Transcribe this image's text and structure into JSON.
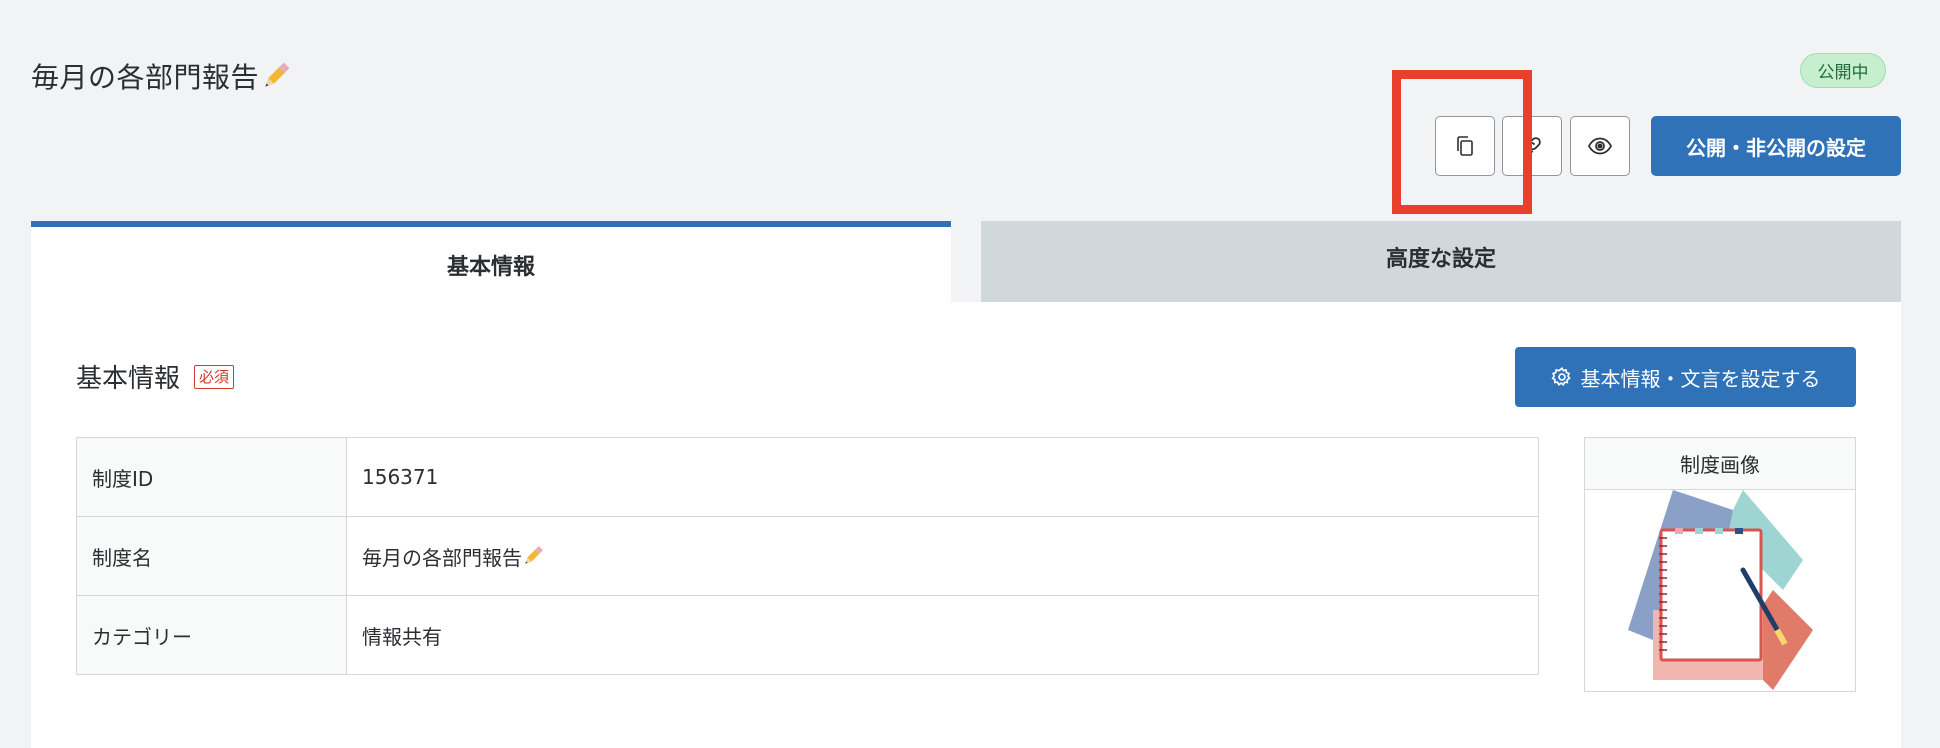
{
  "header": {
    "title": "毎月の各部門報告",
    "status": "公開中",
    "publish_button": "公開・非公開の設定",
    "icons": [
      "copy-icon",
      "link-icon",
      "eye-icon"
    ]
  },
  "tabs": [
    {
      "label": "基本情報",
      "active": true
    },
    {
      "label": "高度な設定",
      "active": false
    }
  ],
  "section": {
    "title": "基本情報",
    "required": "必須",
    "settings_button": "基本情報・文言を設定する"
  },
  "table": {
    "rows": [
      {
        "label": "制度ID",
        "value": "156371"
      },
      {
        "label": "制度名",
        "value": "毎月の各部門報告"
      },
      {
        "label": "カテゴリー",
        "value": "情報共有"
      }
    ]
  },
  "image_panel": {
    "header": "制度画像"
  },
  "colors": {
    "primary": "#2f72b8",
    "highlight": "#e8402a",
    "status_bg": "#c6efd0"
  }
}
